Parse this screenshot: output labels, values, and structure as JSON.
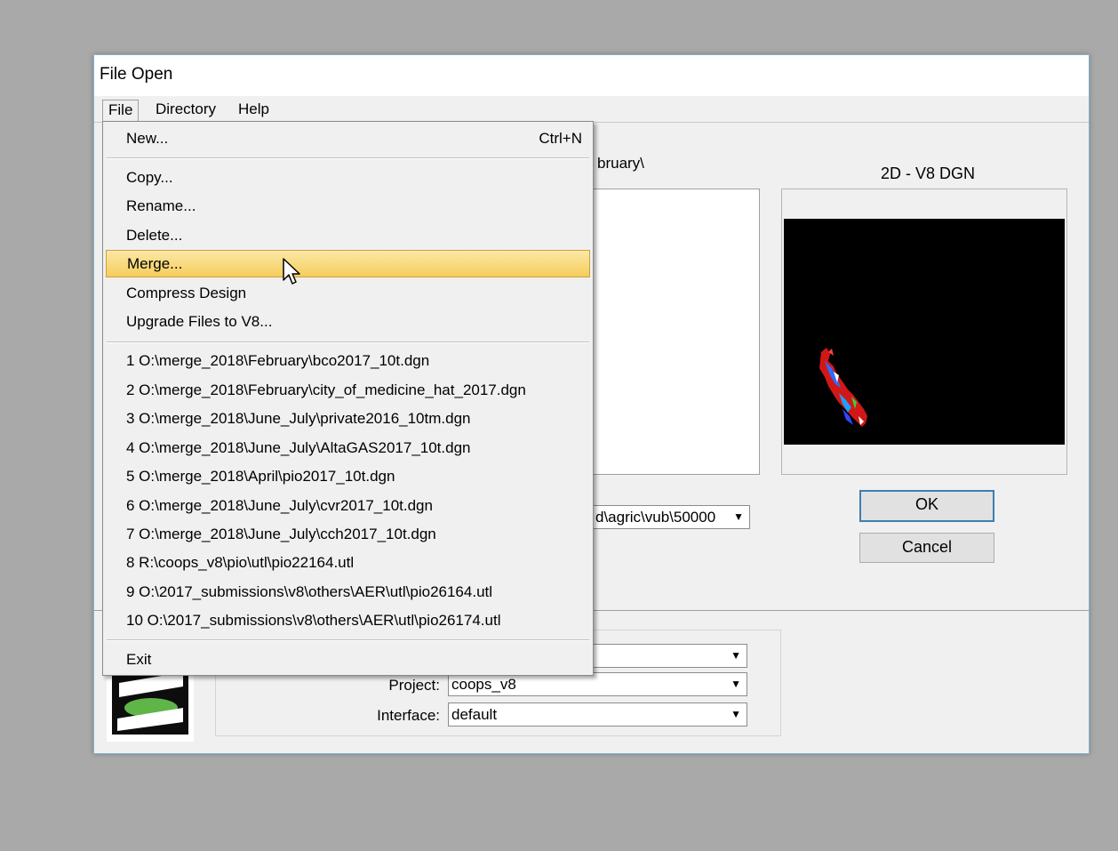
{
  "window": {
    "title": "File Open"
  },
  "menubar": {
    "file": "File",
    "directory": "Directory",
    "help": "Help"
  },
  "dialog": {
    "path_fragment": "bruary\\",
    "preview_title": "2D - V8 DGN",
    "filter_value": "d\\agric\\vub\\50000",
    "ok_label": "OK",
    "cancel_label": "Cancel",
    "workspace_value": "",
    "project_label": "Project:",
    "project_value": "coops_v8",
    "interface_label": "Interface:",
    "interface_value": "default"
  },
  "file_menu": {
    "new": "New...",
    "new_shortcut": "Ctrl+N",
    "copy": "Copy...",
    "rename": "Rename...",
    "delete": "Delete...",
    "merge": "Merge...",
    "compress": "Compress Design",
    "upgrade": "Upgrade Files to V8...",
    "recent": [
      "1 O:\\merge_2018\\February\\bco2017_10t.dgn",
      "2 O:\\merge_2018\\February\\city_of_medicine_hat_2017.dgn",
      "3 O:\\merge_2018\\June_July\\private2016_10tm.dgn",
      "4 O:\\merge_2018\\June_July\\AltaGAS2017_10t.dgn",
      "5 O:\\merge_2018\\April\\pio2017_10t.dgn",
      "6 O:\\merge_2018\\June_July\\cvr2017_10t.dgn",
      "7 O:\\merge_2018\\June_July\\cch2017_10t.dgn",
      "8 R:\\coops_v8\\pio\\utl\\pio22164.utl",
      "9 O:\\2017_submissions\\v8\\others\\AER\\utl\\pio26164.utl",
      "10 O:\\2017_submissions\\v8\\others\\AER\\utl\\pio26174.utl"
    ],
    "exit": "Exit",
    "highlighted_item": "Merge..."
  },
  "colors": {
    "menu_highlight": "#f5cd5c",
    "window_border": "#7fb3cf",
    "preview_bg": "#000000"
  }
}
